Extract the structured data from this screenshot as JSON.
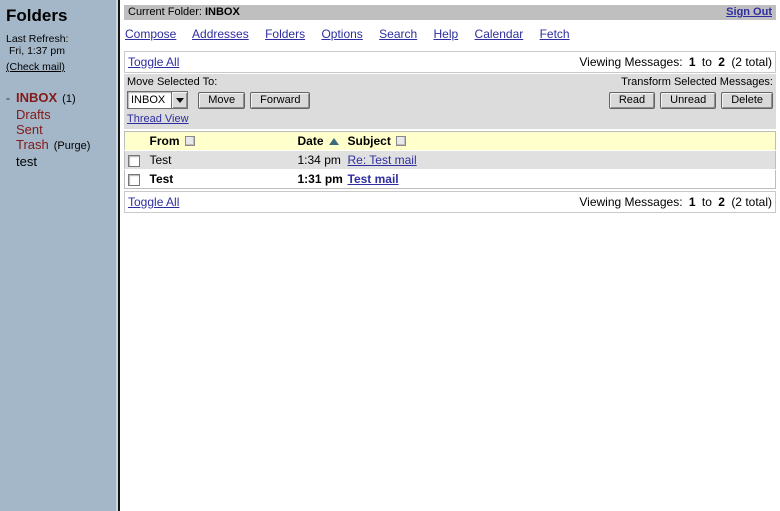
{
  "colors": {
    "sidebar_bg": "#a4b7c8",
    "topbar_bg": "#bfbfbf",
    "toolbar_bg": "#dcdcdc",
    "table_header_bg": "#ffffcc",
    "read_row_bg": "#e0e0e0",
    "link": "#2e2ea0",
    "folder_link": "#831919",
    "sort_arrow": "#3e6b7c"
  },
  "sidebar": {
    "title": "Folders",
    "last_refresh_label": "Last Refresh:",
    "last_refresh_time": "Fri, 1:37 pm",
    "check_mail_link": "(Check mail)",
    "folders": [
      {
        "bullet": "-",
        "name": "INBOX",
        "badge": "(1)"
      },
      {
        "name": "Drafts"
      },
      {
        "name": "Sent"
      },
      {
        "name": "Trash",
        "badge": "(Purge)"
      },
      {
        "name": "test"
      }
    ]
  },
  "topbar": {
    "current_folder_label": "Current Folder:",
    "current_folder": "INBOX",
    "sign_out": "Sign Out"
  },
  "nav": {
    "items": [
      "Compose",
      "Addresses",
      "Folders",
      "Options",
      "Search",
      "Help",
      "Calendar",
      "Fetch"
    ]
  },
  "pager": {
    "toggle_all": "Toggle All",
    "viewing_label": "Viewing Messages:",
    "from": "1",
    "to_word": "to",
    "to": "2",
    "total": "(2 total)"
  },
  "toolbar": {
    "move_label": "Move Selected To:",
    "transform_label": "Transform Selected Messages:",
    "folder_select_value": "INBOX",
    "move_button": "Move",
    "forward_button": "Forward",
    "read_button": "Read",
    "unread_button": "Unread",
    "delete_button": "Delete",
    "thread_view_link": "Thread View"
  },
  "message_list": {
    "columns": {
      "from": "From",
      "date": "Date",
      "subject": "Subject"
    },
    "rows": [
      {
        "from": "Test",
        "date": "1:34 pm",
        "subject": "Re: Test mail",
        "unread": false
      },
      {
        "from": "Test",
        "date": "1:31 pm",
        "subject": "Test mail",
        "unread": true
      }
    ]
  }
}
